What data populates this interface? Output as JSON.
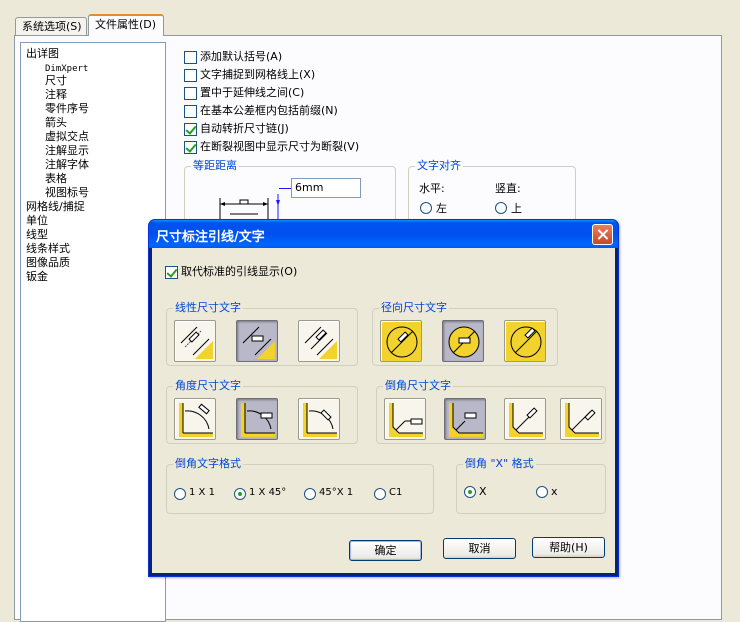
{
  "tabs": [
    {
      "label": "系统选项(S)"
    },
    {
      "label": "文件属性(D)"
    }
  ],
  "tree": {
    "items": [
      {
        "label": "出详图"
      },
      {
        "label": "DimXpert"
      },
      {
        "label": "尺寸"
      },
      {
        "label": "注释"
      },
      {
        "label": "零件序号"
      },
      {
        "label": "箭头"
      },
      {
        "label": "虚拟交点"
      },
      {
        "label": "注解显示"
      },
      {
        "label": "注解字体"
      },
      {
        "label": "表格"
      },
      {
        "label": "视图标号"
      },
      {
        "label": "网格线/捕捉"
      },
      {
        "label": "单位"
      },
      {
        "label": "线型"
      },
      {
        "label": "线条样式"
      },
      {
        "label": "图像品质"
      },
      {
        "label": "钣金"
      }
    ]
  },
  "options": [
    {
      "label": "添加默认括号(A)",
      "checked": false
    },
    {
      "label": "文字捕捉到网格线上(X)",
      "checked": false
    },
    {
      "label": "置中于延伸线之间(C)",
      "checked": false
    },
    {
      "label": "在基本公差框内包括前缀(N)",
      "checked": false
    },
    {
      "label": "自动转折尺寸链(J)",
      "checked": true
    },
    {
      "label": "在断裂视图中显示尺寸为断裂(V)",
      "checked": true
    }
  ],
  "offset_group": {
    "title": "等距距离",
    "value": "6mm"
  },
  "text_align_group": {
    "title": "文字对齐",
    "horizontal_label": "水平:",
    "vertical_label": "竖直:",
    "horizontal_option": "左",
    "vertical_option": "上"
  },
  "dialog": {
    "title": "尺寸标注引线/文字",
    "override_label": "取代标准的引线显示(O)",
    "override_checked": true,
    "linear_group": "线性尺寸文字",
    "radial_group": "径向尺寸文字",
    "angular_group": "角度尺寸文字",
    "chamfer_group": "倒角尺寸文字",
    "chamfer_format_group": "倒角文字格式",
    "chamfer_format_options": [
      "1 X 1",
      "1 X 45°",
      "45°X 1",
      "C1"
    ],
    "chamfer_format_selected": 1,
    "x_format_group": "倒角 \"X\" 格式",
    "x_format_options": [
      "X",
      "x"
    ],
    "x_format_selected": 0,
    "ok_label": "确定",
    "cancel_label": "取消",
    "help_label": "帮助(H)"
  },
  "colors": {
    "accent_blue": "#0046d5",
    "title_blue": "#0053ee",
    "icon_yellow": "#f2d22c",
    "check_green": "#21a121"
  }
}
